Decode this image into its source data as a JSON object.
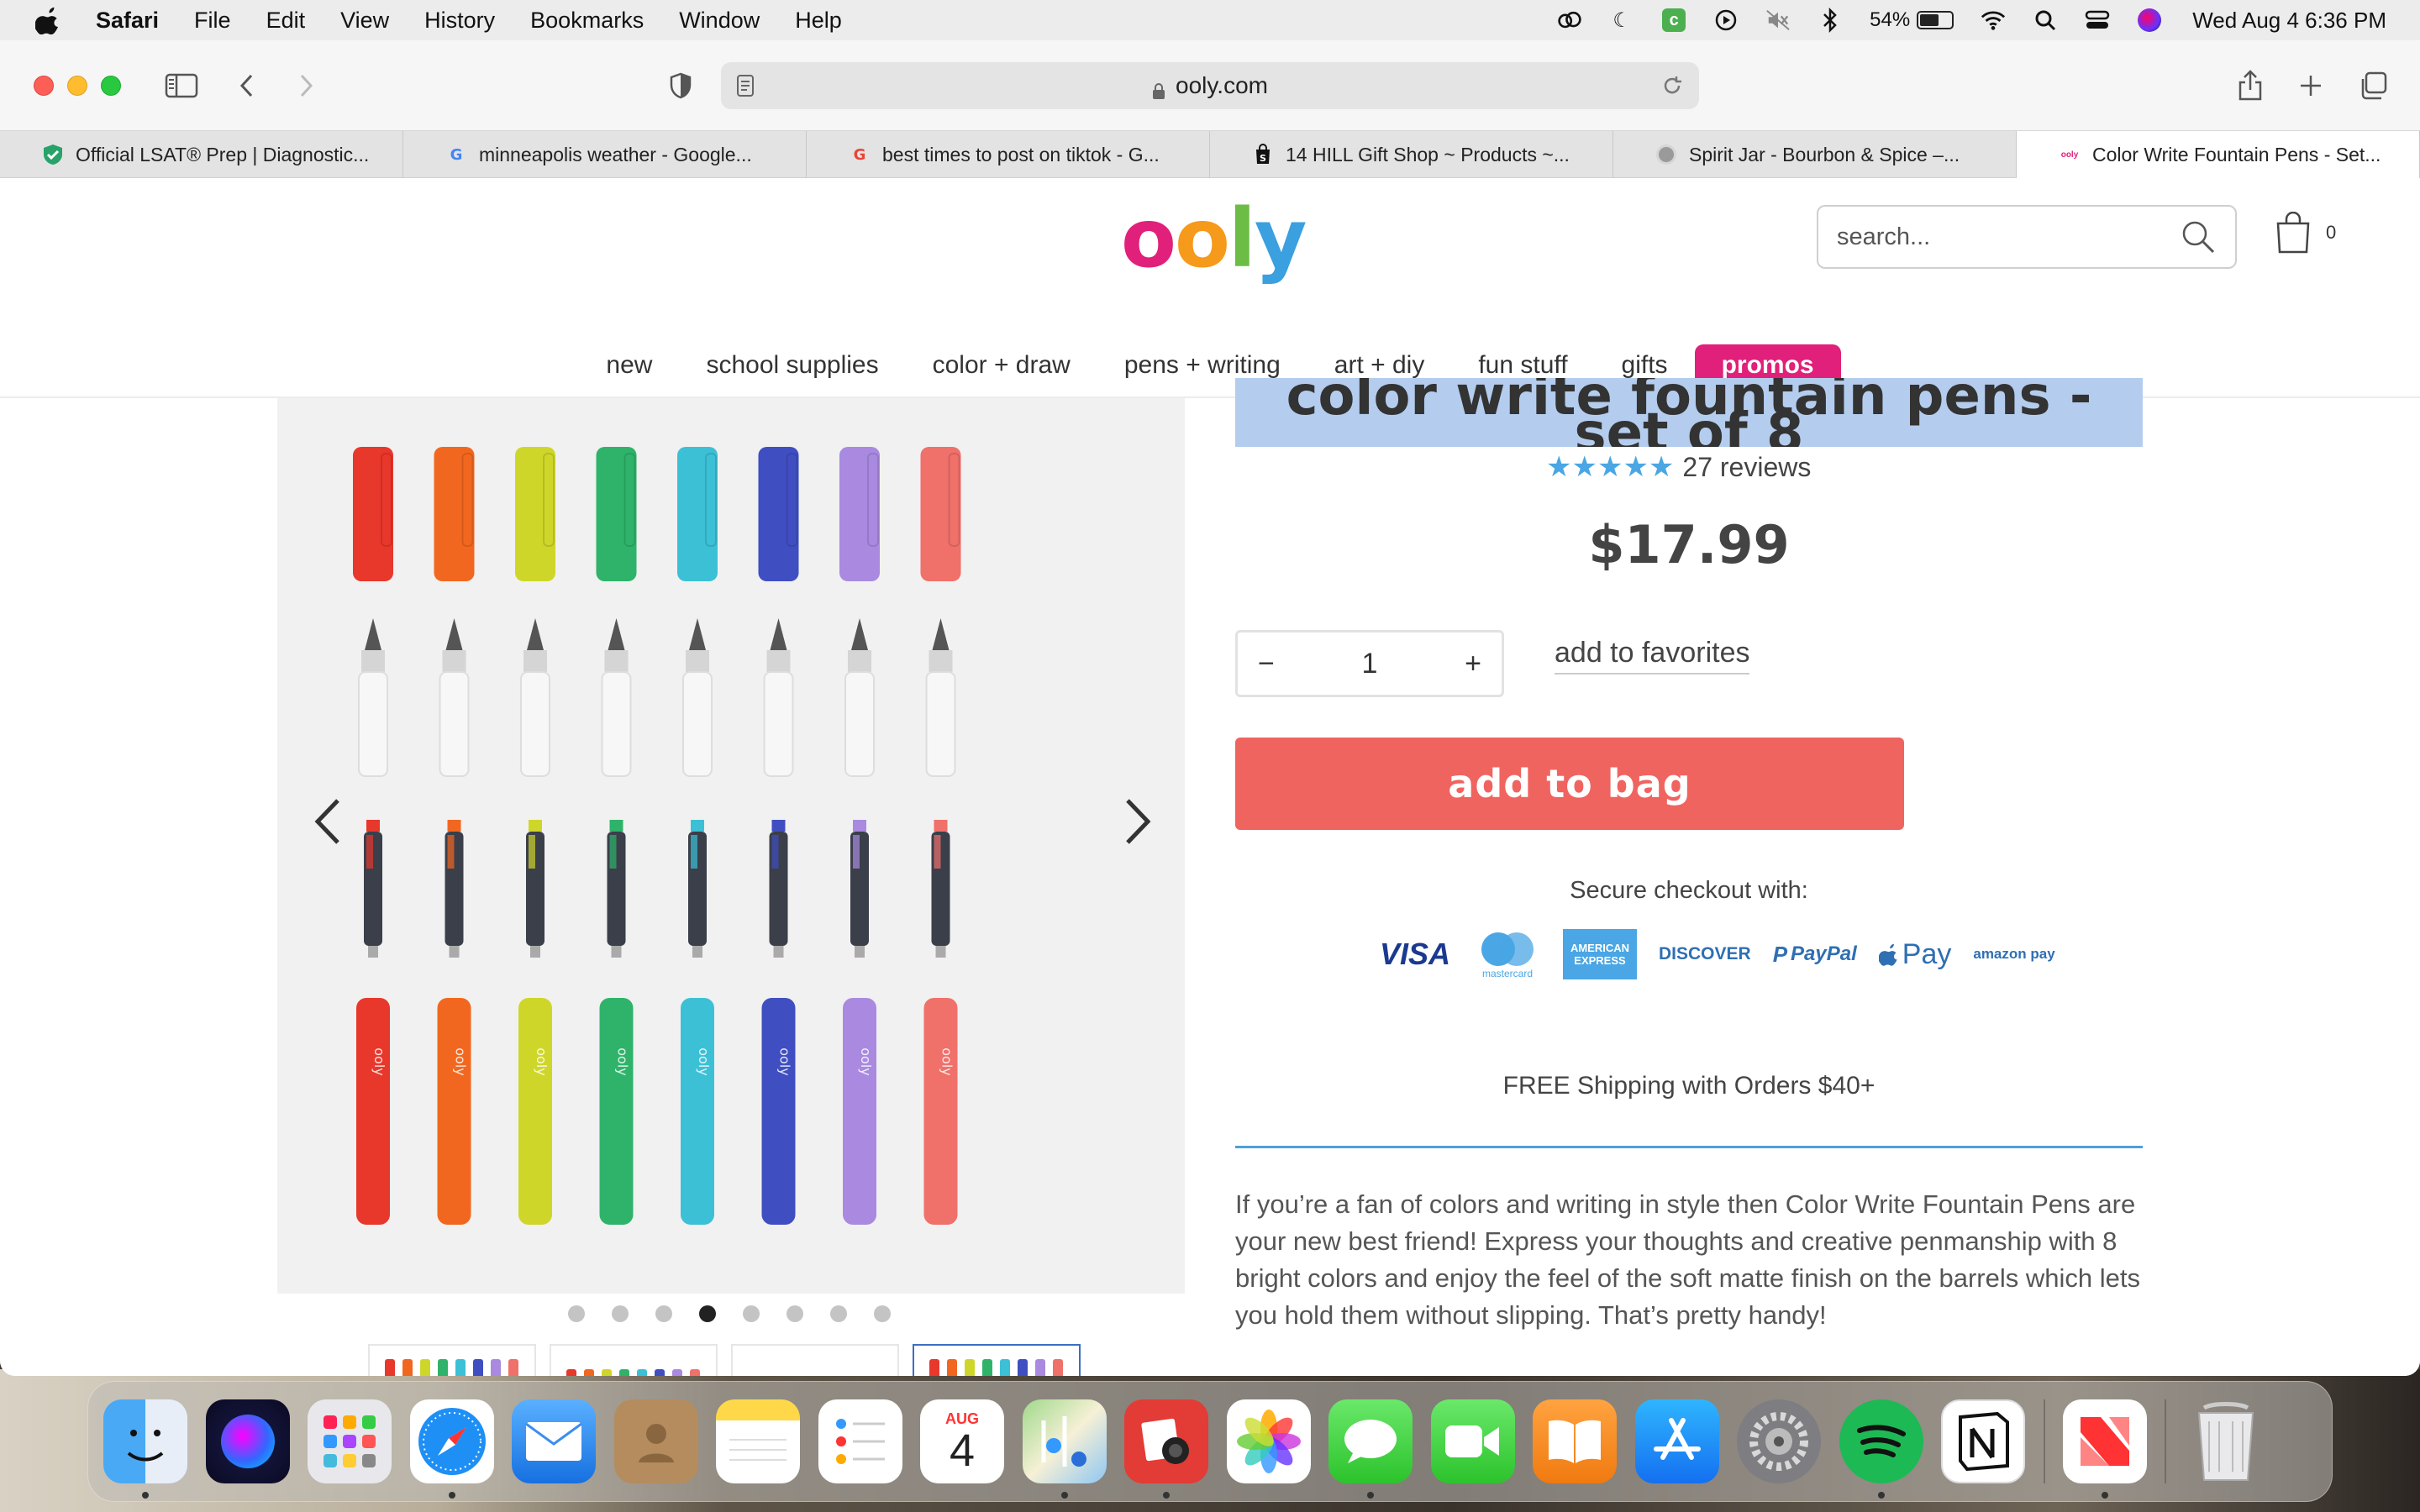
{
  "menubar": {
    "app": "Safari",
    "items": [
      "File",
      "Edit",
      "View",
      "History",
      "Bookmarks",
      "Window",
      "Help"
    ],
    "battery": "54%",
    "clock": "Wed Aug 4  6:36 PM"
  },
  "browser": {
    "url": "ooly.com",
    "tabs": [
      {
        "title": "Official LSAT® Prep | Diagnostic...",
        "icon": "shield-check-icon",
        "color": "#27a36a"
      },
      {
        "title": "minneapolis weather - Google...",
        "icon": "google-icon",
        "color": "#4285f4"
      },
      {
        "title": "best times to post on tiktok - G...",
        "icon": "google-icon",
        "color": "#4285f4"
      },
      {
        "title": "14 HILL Gift Shop ~ Products ~...",
        "icon": "shopify-bag-icon",
        "color": "#111111"
      },
      {
        "title": "Spirit Jar - Bourbon & Spice –...",
        "icon": "spirit-jar-icon",
        "color": "#8a8a8a"
      },
      {
        "title": "Color Write Fountain Pens - Set...",
        "icon": "ooly-icon",
        "color": "#e0207a",
        "active": true
      }
    ]
  },
  "site": {
    "logo": {
      "letters": [
        "o",
        "o",
        "l",
        "y"
      ],
      "colors": [
        "#e0207a",
        "#f59a1b",
        "#6cbd45",
        "#3aa0e0"
      ]
    },
    "search_placeholder": "search...",
    "cart_count": "0",
    "nav": [
      "new",
      "school supplies",
      "color + draw",
      "pens + writing",
      "art + diy",
      "fun stuff",
      "gifts"
    ],
    "promo": "promos"
  },
  "product": {
    "title": "color write fountain pens - set of 8",
    "stars": "★★★★★",
    "reviews": "27 reviews",
    "price": "$17.99",
    "qty_minus": "−",
    "qty": "1",
    "qty_plus": "+",
    "favorites": "add to favorites",
    "add_to_bag": "add to bag",
    "secure": "Secure checkout with:",
    "payments": [
      "VISA",
      "mastercard",
      "AMERICAN EXPRESS",
      "DISCOVER",
      "PayPal",
      "Pay",
      "amazon pay"
    ],
    "shipping": "FREE Shipping with Orders $40+",
    "description": "If you’re a fan of colors and writing in style then Color Write Fountain Pens are your new best friend! Express your thoughts and creative penmanship with 8 bright colors and enjoy the feel of the soft matte finish on the barrels which lets you hold them without slipping. That’s pretty handy!",
    "pen_colors": [
      "#e8372b",
      "#f2671f",
      "#cfd62a",
      "#2fb36a",
      "#3cc0d6",
      "#3f4fc1",
      "#a98ae0",
      "#f0706a"
    ],
    "barrel_brand": "ooly",
    "gallery_active_dot": 3,
    "gallery_dots": 8
  },
  "dock": {
    "calendar_month": "AUG",
    "calendar_day": "4"
  }
}
